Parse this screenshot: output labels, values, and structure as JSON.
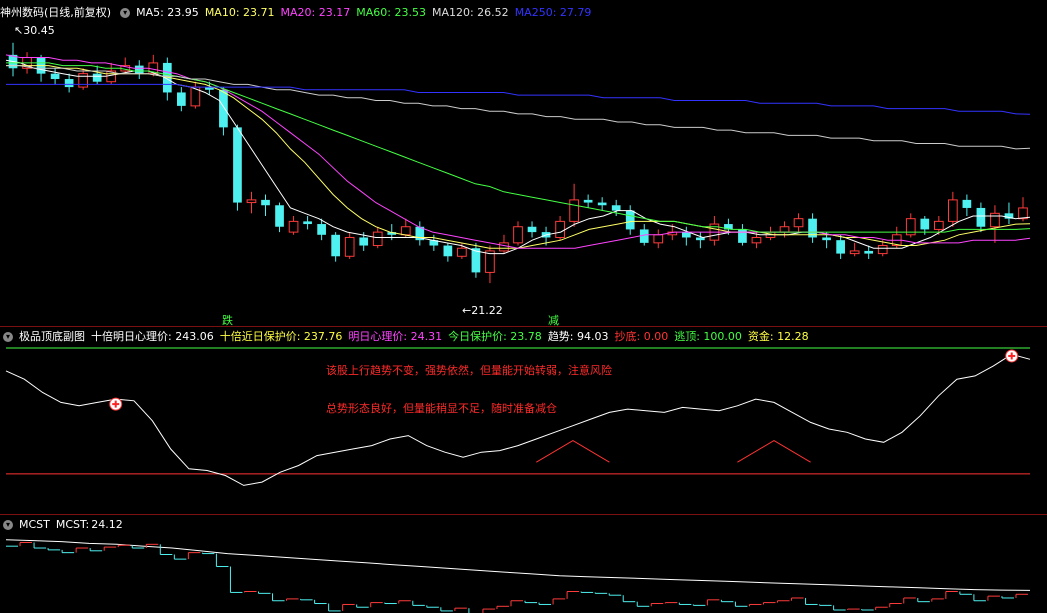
{
  "main": {
    "title": "神州数码(日线,前复权)",
    "ma": [
      {
        "label": "MA5:",
        "value": "23.95",
        "color": "#ffffff"
      },
      {
        "label": "MA10:",
        "value": "23.71",
        "color": "#ffff66"
      },
      {
        "label": "MA20:",
        "value": "23.17",
        "color": "#ff44ff"
      },
      {
        "label": "MA60:",
        "value": "23.53",
        "color": "#44ff44"
      },
      {
        "label": "MA120:",
        "value": "26.52",
        "color": "#dddddd"
      },
      {
        "label": "MA250:",
        "value": "27.79",
        "color": "#3333ff"
      }
    ],
    "high_label": "30.45",
    "low_label": "21.22",
    "markers": [
      {
        "text": "跌",
        "color": "#44ff44"
      },
      {
        "text": "减",
        "color": "#44ff44"
      }
    ]
  },
  "sub1": {
    "name": "极品顶底副图",
    "fields": [
      {
        "label": "十倍明日心理价:",
        "value": "243.06",
        "color": "#ffffff"
      },
      {
        "label": "十倍近日保护价:",
        "value": "237.76",
        "color": "#ffff44"
      },
      {
        "label": "明日心理价:",
        "value": "24.31",
        "color": "#ff44ff"
      },
      {
        "label": "今日保护价:",
        "value": "23.78",
        "color": "#44ff44"
      },
      {
        "label": "趋势:",
        "value": "94.03",
        "color": "#ffffff"
      },
      {
        "label": "抄底:",
        "value": "0.00",
        "color": "#ff3333"
      },
      {
        "label": "逃顶:",
        "value": "100.00",
        "color": "#44ff44"
      },
      {
        "label": "资金:",
        "value": "12.28",
        "color": "#ffff44"
      }
    ],
    "note1": "该股上行趋势不变，强势依然，但量能开始转弱，注意风险",
    "note2": "总势形态良好，但量能稍显不足，随时准备减仓"
  },
  "sub2": {
    "name": "MCST",
    "label": "MCST:",
    "value": "24.12"
  },
  "chart_data": [
    {
      "type": "candlestick",
      "ylim": [
        20.5,
        31.0
      ],
      "candles": [
        [
          30.0,
          29.5,
          30.45,
          29.2
        ],
        [
          29.5,
          29.9,
          30.1,
          29.3
        ],
        [
          29.9,
          29.3,
          30.0,
          29.0
        ],
        [
          29.3,
          29.1,
          29.5,
          28.9
        ],
        [
          29.1,
          28.8,
          29.3,
          28.6
        ],
        [
          28.8,
          29.3,
          29.5,
          28.7
        ],
        [
          29.3,
          29.0,
          29.6,
          28.9
        ],
        [
          29.0,
          29.4,
          29.7,
          28.9
        ],
        [
          29.4,
          29.6,
          29.9,
          29.3
        ],
        [
          29.6,
          29.3,
          29.8,
          29.1
        ],
        [
          29.3,
          29.7,
          30.0,
          29.2
        ],
        [
          29.7,
          28.6,
          29.9,
          28.3
        ],
        [
          28.6,
          28.1,
          28.8,
          27.9
        ],
        [
          28.1,
          28.8,
          29.0,
          28.0
        ],
        [
          28.8,
          28.7,
          29.0,
          28.5
        ],
        [
          28.7,
          27.3,
          28.8,
          27.0
        ],
        [
          27.3,
          24.5,
          27.4,
          24.2
        ],
        [
          24.5,
          24.6,
          24.9,
          24.1
        ],
        [
          24.6,
          24.4,
          24.8,
          24.0
        ],
        [
          24.4,
          23.6,
          24.5,
          23.4
        ],
        [
          23.4,
          23.8,
          24.0,
          23.3
        ],
        [
          23.8,
          23.7,
          24.0,
          23.5
        ],
        [
          23.7,
          23.3,
          23.9,
          23.1
        ],
        [
          23.3,
          22.5,
          23.4,
          22.3
        ],
        [
          22.5,
          23.2,
          23.4,
          22.4
        ],
        [
          23.2,
          22.9,
          23.4,
          22.7
        ],
        [
          22.9,
          23.4,
          23.6,
          22.8
        ],
        [
          23.4,
          23.3,
          23.7,
          23.1
        ],
        [
          23.3,
          23.6,
          23.9,
          23.2
        ],
        [
          23.6,
          23.1,
          23.8,
          22.9
        ],
        [
          23.1,
          22.9,
          23.3,
          22.7
        ],
        [
          22.9,
          22.5,
          23.0,
          22.3
        ],
        [
          22.5,
          22.8,
          23.0,
          22.4
        ],
        [
          22.8,
          21.9,
          23.0,
          21.7
        ],
        [
          21.9,
          22.7,
          22.9,
          21.5
        ],
        [
          22.7,
          23.0,
          23.3,
          22.6
        ],
        [
          23.0,
          23.6,
          23.8,
          22.9
        ],
        [
          23.6,
          23.4,
          23.8,
          23.2
        ],
        [
          23.4,
          23.2,
          23.6,
          22.9
        ],
        [
          23.2,
          23.8,
          24.0,
          23.1
        ],
        [
          23.8,
          24.6,
          25.2,
          23.6
        ],
        [
          24.6,
          24.5,
          24.8,
          24.3
        ],
        [
          24.5,
          24.4,
          24.7,
          24.2
        ],
        [
          24.4,
          24.2,
          24.6,
          24.0
        ],
        [
          24.2,
          23.5,
          24.4,
          23.3
        ],
        [
          23.5,
          23.0,
          23.7,
          22.9
        ],
        [
          23.0,
          23.3,
          23.5,
          22.8
        ],
        [
          23.3,
          23.4,
          23.7,
          23.1
        ],
        [
          23.4,
          23.2,
          23.6,
          22.9
        ],
        [
          23.2,
          23.1,
          23.4,
          22.8
        ],
        [
          23.1,
          23.7,
          24.0,
          22.9
        ],
        [
          23.7,
          23.5,
          23.9,
          23.3
        ],
        [
          23.5,
          23.0,
          23.7,
          22.9
        ],
        [
          23.0,
          23.2,
          23.4,
          22.8
        ],
        [
          23.2,
          23.4,
          23.6,
          23.1
        ],
        [
          23.4,
          23.6,
          23.8,
          23.2
        ],
        [
          23.6,
          23.9,
          24.1,
          23.4
        ],
        [
          23.9,
          23.2,
          24.1,
          23.0
        ],
        [
          23.2,
          23.1,
          23.4,
          22.8
        ],
        [
          23.1,
          22.6,
          23.3,
          22.4
        ],
        [
          22.6,
          22.7,
          23.0,
          22.5
        ],
        [
          22.7,
          22.6,
          22.9,
          22.4
        ],
        [
          22.6,
          22.9,
          23.1,
          22.5
        ],
        [
          22.9,
          23.3,
          23.6,
          22.8
        ],
        [
          23.3,
          23.9,
          24.1,
          23.2
        ],
        [
          23.9,
          23.5,
          24.0,
          23.3
        ],
        [
          23.5,
          23.8,
          24.0,
          23.3
        ],
        [
          23.8,
          24.6,
          24.9,
          23.6
        ],
        [
          24.6,
          24.3,
          24.8,
          24.0
        ],
        [
          24.3,
          23.6,
          24.5,
          23.4
        ],
        [
          23.6,
          24.1,
          24.4,
          23.0
        ],
        [
          24.1,
          23.9,
          24.5,
          23.7
        ],
        [
          23.9,
          24.3,
          24.7,
          23.8
        ]
      ],
      "ma_series": {
        "MA5": [
          29.8,
          29.7,
          29.5,
          29.4,
          29.3,
          29.2,
          29.2,
          29.2,
          29.3,
          29.4,
          29.4,
          29.2,
          28.9,
          28.8,
          28.6,
          28.3,
          27.5,
          26.7,
          25.9,
          25.1,
          24.3,
          24.1,
          23.9,
          23.6,
          23.4,
          23.3,
          23.2,
          23.2,
          23.2,
          23.2,
          23.1,
          23.0,
          22.9,
          22.7,
          22.6,
          22.6,
          22.8,
          23.1,
          23.3,
          23.4,
          23.7,
          23.9,
          24.0,
          24.2,
          24.2,
          23.9,
          23.7,
          23.6,
          23.4,
          23.2,
          23.3,
          23.4,
          23.4,
          23.3,
          23.3,
          23.3,
          23.4,
          23.4,
          23.3,
          23.2,
          23.0,
          22.8,
          22.8,
          22.8,
          23.0,
          23.2,
          23.5,
          23.8,
          24.0,
          24.0,
          24.0,
          23.9,
          23.95
        ],
        "MA10": [
          29.6,
          29.6,
          29.6,
          29.6,
          29.5,
          29.5,
          29.4,
          29.3,
          29.3,
          29.3,
          29.3,
          29.2,
          29.1,
          29.0,
          28.9,
          28.7,
          28.4,
          28.0,
          27.6,
          27.1,
          26.5,
          26.0,
          25.4,
          24.8,
          24.3,
          23.9,
          23.6,
          23.4,
          23.3,
          23.2,
          23.2,
          23.1,
          23.0,
          22.9,
          22.8,
          22.8,
          22.8,
          22.9,
          23.0,
          23.1,
          23.3,
          23.5,
          23.6,
          23.7,
          23.8,
          23.8,
          23.8,
          23.8,
          23.7,
          23.6,
          23.5,
          23.4,
          23.4,
          23.4,
          23.3,
          23.3,
          23.3,
          23.3,
          23.3,
          23.2,
          23.2,
          23.1,
          23.0,
          22.9,
          22.9,
          23.0,
          23.1,
          23.3,
          23.4,
          23.5,
          23.6,
          23.7,
          23.71
        ],
        "MA20": [
          30.0,
          29.9,
          29.9,
          29.9,
          29.8,
          29.8,
          29.7,
          29.7,
          29.6,
          29.5,
          29.5,
          29.4,
          29.3,
          29.1,
          29.0,
          28.8,
          28.5,
          28.2,
          27.9,
          27.5,
          27.1,
          26.7,
          26.3,
          25.8,
          25.3,
          24.9,
          24.5,
          24.2,
          23.9,
          23.6,
          23.4,
          23.3,
          23.2,
          23.1,
          23.0,
          22.9,
          22.8,
          22.8,
          22.8,
          22.8,
          22.8,
          22.9,
          23.0,
          23.1,
          23.2,
          23.3,
          23.3,
          23.4,
          23.4,
          23.4,
          23.4,
          23.4,
          23.4,
          23.4,
          23.4,
          23.4,
          23.4,
          23.4,
          23.3,
          23.3,
          23.2,
          23.2,
          23.1,
          23.1,
          23.0,
          23.0,
          23.0,
          23.0,
          23.1,
          23.1,
          23.1,
          23.1,
          23.17
        ],
        "MA60": [
          29.7,
          29.7,
          29.7,
          29.7,
          29.6,
          29.6,
          29.6,
          29.5,
          29.5,
          29.4,
          29.4,
          29.3,
          29.2,
          29.1,
          29.0,
          28.8,
          28.6,
          28.4,
          28.2,
          28.0,
          27.8,
          27.6,
          27.4,
          27.2,
          27.0,
          26.8,
          26.6,
          26.4,
          26.2,
          26.0,
          25.8,
          25.6,
          25.4,
          25.2,
          25.1,
          24.9,
          24.8,
          24.7,
          24.6,
          24.5,
          24.4,
          24.3,
          24.2,
          24.1,
          24.0,
          23.9,
          23.8,
          23.8,
          23.7,
          23.6,
          23.6,
          23.5,
          23.5,
          23.4,
          23.4,
          23.4,
          23.4,
          23.4,
          23.4,
          23.4,
          23.4,
          23.4,
          23.4,
          23.4,
          23.4,
          23.4,
          23.4,
          23.5,
          23.5,
          23.5,
          23.5,
          23.5,
          23.53
        ],
        "MA120": [
          29.6,
          29.6,
          29.5,
          29.5,
          29.5,
          29.4,
          29.4,
          29.4,
          29.3,
          29.3,
          29.3,
          29.2,
          29.2,
          29.1,
          29.1,
          29.0,
          28.9,
          28.9,
          28.8,
          28.7,
          28.7,
          28.6,
          28.5,
          28.5,
          28.4,
          28.4,
          28.3,
          28.3,
          28.2,
          28.2,
          28.1,
          28.1,
          28.0,
          28.0,
          27.9,
          27.9,
          27.8,
          27.8,
          27.7,
          27.7,
          27.6,
          27.6,
          27.6,
          27.5,
          27.5,
          27.4,
          27.4,
          27.3,
          27.3,
          27.3,
          27.2,
          27.2,
          27.1,
          27.1,
          27.1,
          27.0,
          27.0,
          27.0,
          26.9,
          26.9,
          26.9,
          26.8,
          26.8,
          26.8,
          26.7,
          26.7,
          26.7,
          26.6,
          26.6,
          26.6,
          26.6,
          26.5,
          26.52
        ],
        "MA250": [
          28.9,
          28.9,
          28.9,
          28.9,
          28.9,
          28.9,
          28.9,
          28.9,
          28.9,
          28.9,
          28.9,
          28.9,
          28.9,
          28.8,
          28.8,
          28.8,
          28.8,
          28.8,
          28.8,
          28.8,
          28.8,
          28.7,
          28.7,
          28.7,
          28.7,
          28.7,
          28.7,
          28.7,
          28.7,
          28.6,
          28.6,
          28.6,
          28.6,
          28.6,
          28.6,
          28.6,
          28.5,
          28.5,
          28.5,
          28.5,
          28.5,
          28.5,
          28.4,
          28.4,
          28.4,
          28.4,
          28.4,
          28.3,
          28.3,
          28.3,
          28.3,
          28.3,
          28.3,
          28.2,
          28.2,
          28.2,
          28.2,
          28.2,
          28.1,
          28.1,
          28.1,
          28.1,
          28.0,
          28.0,
          28.0,
          28.0,
          28.0,
          27.9,
          27.9,
          27.9,
          27.9,
          27.8,
          27.79
        ]
      }
    },
    {
      "type": "line",
      "ylim": [
        0,
        100
      ],
      "white_line": [
        85,
        80,
        72,
        66,
        64,
        66,
        68,
        67,
        55,
        38,
        26,
        25,
        22,
        16,
        18,
        24,
        28,
        34,
        36,
        38,
        40,
        44,
        46,
        40,
        36,
        33,
        36,
        37,
        40,
        44,
        48,
        52,
        56,
        60,
        62,
        61,
        60,
        63,
        62,
        61,
        64,
        68,
        66,
        60,
        54,
        50,
        48,
        44,
        42,
        48,
        58,
        70,
        80,
        82,
        88,
        95,
        92
      ],
      "red_baseline": 23,
      "red_spikes": [
        [
          29,
          30
        ],
        [
          31,
          43
        ],
        [
          33,
          30
        ],
        [
          40,
          30
        ],
        [
          42,
          43
        ],
        [
          44,
          30
        ]
      ],
      "cross_markers": [
        [
          6,
          65
        ],
        [
          55,
          94
        ]
      ]
    },
    {
      "type": "line",
      "ylim": [
        22,
        30
      ],
      "mcst_line": [
        29.6,
        29.5,
        29.4,
        29.2,
        29.1,
        28.9,
        28.7,
        28.4,
        28.1,
        27.9,
        27.7,
        27.5,
        27.3,
        27.1,
        26.9,
        26.7,
        26.5,
        26.3,
        26.1,
        25.9,
        25.7,
        25.6,
        25.5,
        25.4,
        25.3,
        25.2,
        25.1,
        25.0,
        24.9,
        24.8,
        24.7,
        24.6,
        24.5,
        24.4,
        24.3,
        24.2,
        24.15,
        24.12
      ]
    }
  ]
}
